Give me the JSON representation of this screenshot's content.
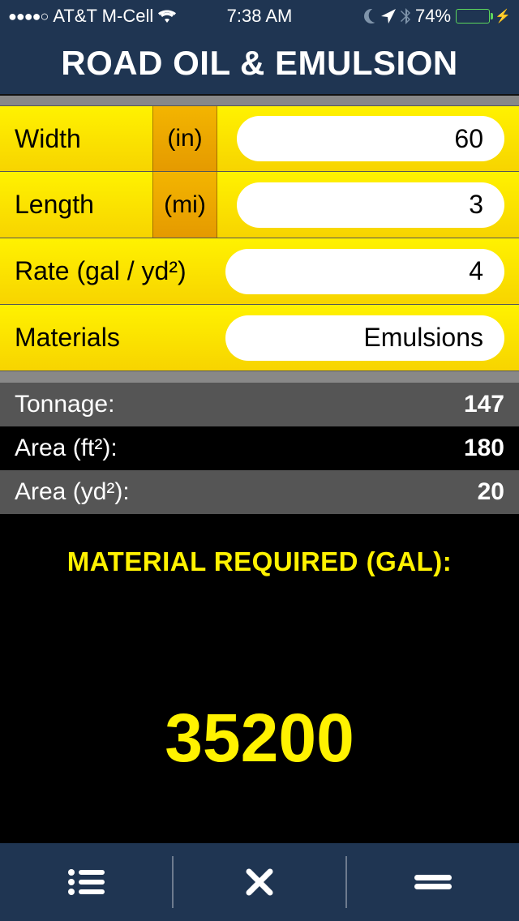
{
  "status": {
    "signal_dots": "●●●●○",
    "carrier": "AT&T M-Cell",
    "time": "7:38 AM",
    "battery_pct": "74%"
  },
  "title": "ROAD OIL & EMULSION",
  "inputs": {
    "width": {
      "label": "Width",
      "unit": "(in)",
      "value": "60"
    },
    "length": {
      "label": "Length",
      "unit": "(mi)",
      "value": "3"
    },
    "rate": {
      "label": "Rate (gal / yd²)",
      "value": "4"
    },
    "materials": {
      "label": "Materials",
      "value": "Emulsions"
    }
  },
  "results": {
    "tonnage": {
      "label": "Tonnage:",
      "value": "147"
    },
    "area_ft2": {
      "label": "Area (ft²):",
      "value": "180"
    },
    "area_yd2": {
      "label": "Area (yd²):",
      "value": "20"
    }
  },
  "material_required": {
    "heading": "MATERIAL REQUIRED (GAL):",
    "value": "35200"
  },
  "toolbar_icons": {
    "list": "list-icon",
    "close": "close-icon",
    "menu": "menu-icon"
  }
}
